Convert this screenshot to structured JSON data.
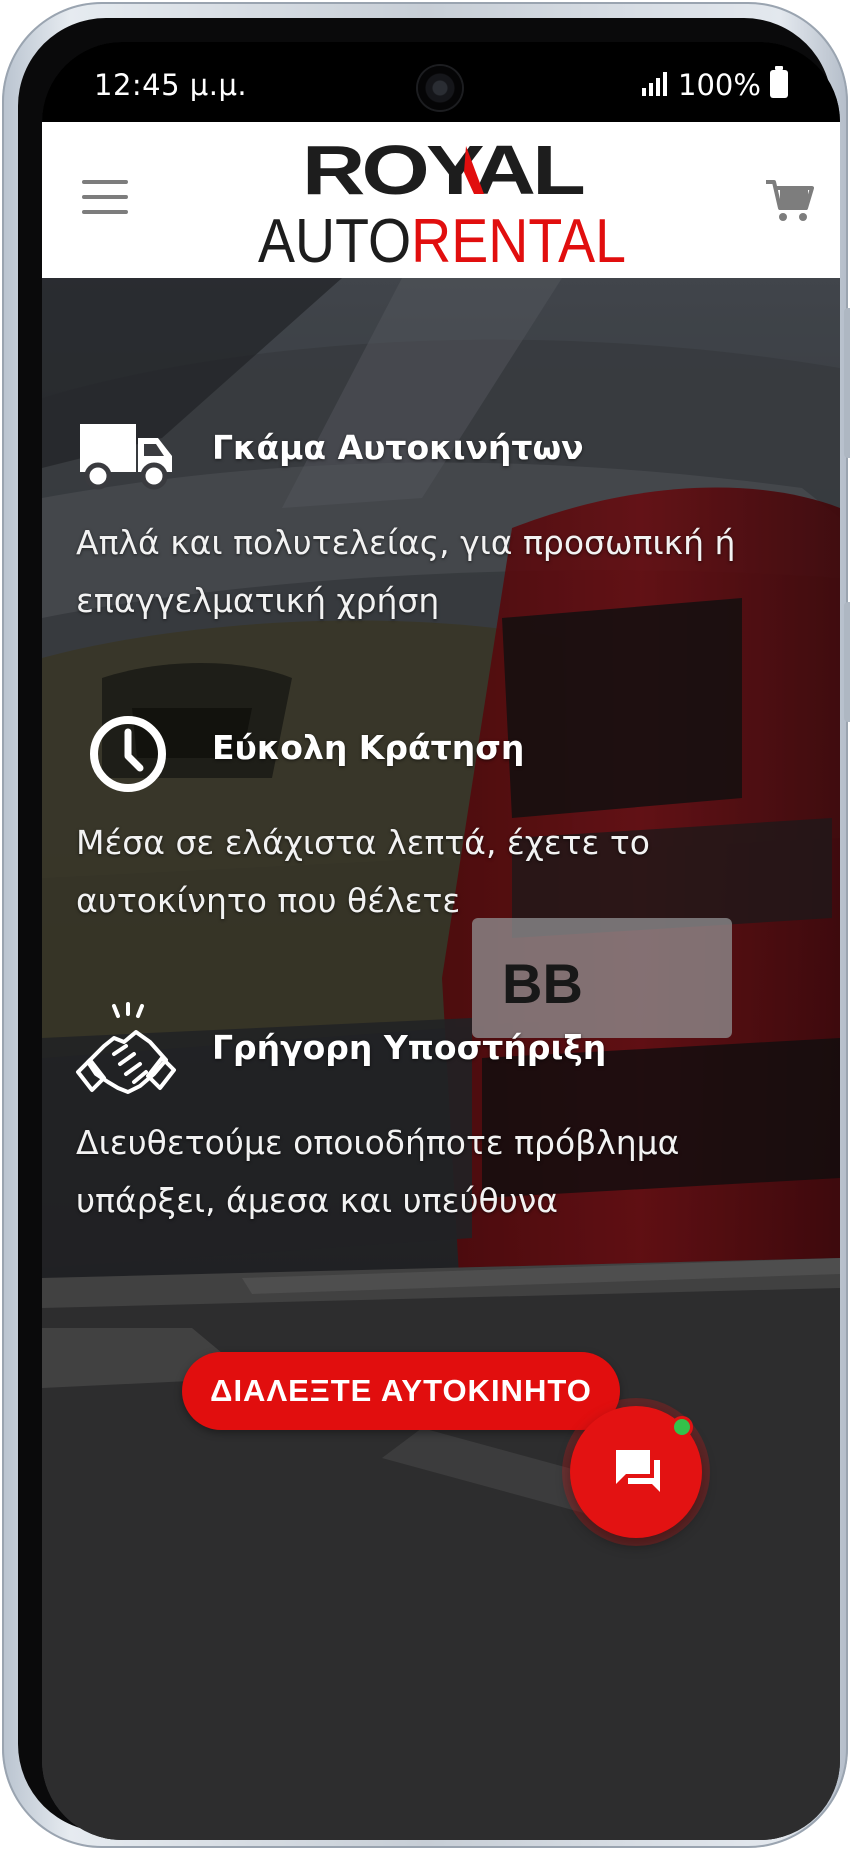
{
  "status_bar": {
    "time": "12:45 μ.μ.",
    "battery": "100%"
  },
  "header": {
    "logo_line1": "ROYAL",
    "logo_auto": "AUTO",
    "logo_rental": "RENTAL",
    "menu_icon": "hamburger-icon",
    "cart_icon": "cart-icon"
  },
  "features": [
    {
      "icon": "truck-icon",
      "title": "Γκάμα Αυτοκινήτων",
      "description": "Απλά και πολυτελείας, για προσωπική ή επαγγελματική χρήση"
    },
    {
      "icon": "clock-icon",
      "title": "Εύκολη Κράτηση",
      "description": "Μέσα σε ελάχιστα λεπτά, έχετε το αυτοκίνητο που θέλετε"
    },
    {
      "icon": "handshake-icon",
      "title": "Γρήγορη Υποστήριξη",
      "description": "Διευθετούμε οποιοδήποτε πρόβλημα υπάρξει, άμεσα και υπεύθυνα"
    }
  ],
  "cta": {
    "label": "ΔΙΑΛΕΞΤΕ ΑΥΤΟΚΙΝΗΤΟ"
  },
  "chat": {
    "icon": "chat-bubbles-icon",
    "online": true
  },
  "colors": {
    "brand_red": "#e10e0e",
    "logo_dark": "#1d1d1d",
    "online_green": "#33c24a"
  }
}
